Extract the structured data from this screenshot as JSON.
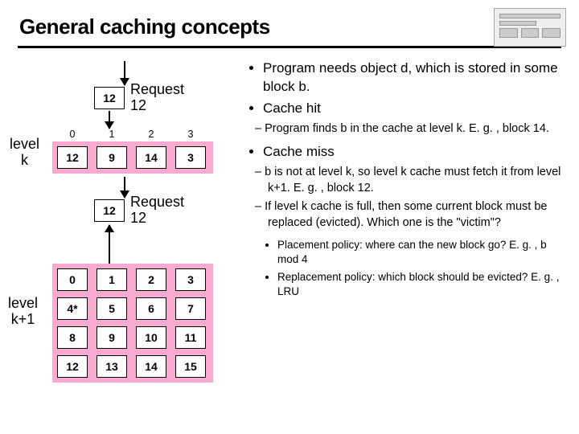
{
  "title": "General caching  concepts",
  "diagram": {
    "request_top": {
      "block": "12",
      "label": "Request\n12"
    },
    "level_k": {
      "label": "level\nk",
      "headers": [
        "0",
        "1",
        "2",
        "3"
      ],
      "cells": [
        "12",
        "9",
        "14",
        "3"
      ]
    },
    "request_mid": {
      "block": "12",
      "label": "Request\n12"
    },
    "level_k1": {
      "label": "level\nk+1",
      "rows": [
        [
          "0",
          "1",
          "2",
          "3"
        ],
        [
          "4*",
          "5",
          "6",
          "7"
        ],
        [
          "8",
          "9",
          "10",
          "11"
        ],
        [
          "12",
          "13",
          "14",
          "15"
        ]
      ]
    }
  },
  "bullets": {
    "b1": "Program needs object d, which is stored in some block b.",
    "b2": "Cache hit",
    "b2_sub": "Program finds  b  in the cache at level k.  E. g. ,  block 14.",
    "b3": "Cache miss",
    "b3_sub1": "b is not at level k, so level k cache must fetch it from level k+1.          E. g. ,  block 12.",
    "b3_sub2": "If level k cache is full, then some current block must be replaced (evicted). Which one is the \"victim\"?",
    "b3_sub2_a": "Placement policy: where can the new block go? E. g. , b mod 4",
    "b3_sub2_b": "Replacement policy: which block should be evicted? E. g. , LRU"
  }
}
